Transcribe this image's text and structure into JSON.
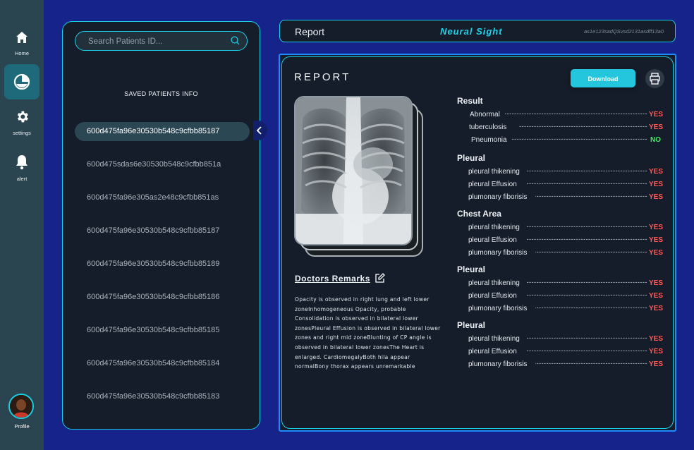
{
  "nav": {
    "items": [
      {
        "label": "Home",
        "icon": "home-icon"
      },
      {
        "label": "",
        "icon": "pie-chart-icon"
      },
      {
        "label": "settings",
        "icon": "gear-icon"
      },
      {
        "label": "alert",
        "icon": "bell-icon"
      }
    ],
    "profile_label": "Profile"
  },
  "patients": {
    "search_placeholder": "Search Patients ID...",
    "title": "SAVED PATIENTS INFO",
    "list": [
      "600d475fa96e30530b548c9cfbb85187",
      "600d475sdas6e30530b548c9cfbb851a",
      "600d475fa96e305as2e48c9cfbb851as",
      "600d475fa96e30530b548c9cfbb85187",
      "600d475fa96e30530b548c9cfbb85189",
      "600d475fa96e30530b548c9cfbb85186",
      "600d475fa96e30530b548c9cfbb85185",
      "600d475fa96e30530b548c9cfbb85184",
      "600d475fa96e30530b548c9cfbb85183"
    ],
    "selected_index": 0
  },
  "header": {
    "title": "Report",
    "brand": "Neural Sight",
    "hash": "as1e123sadQSvsd2131asdff13a0"
  },
  "report": {
    "title": "REPORT",
    "download_label": "Download",
    "remarks_title": "Doctors Remarks",
    "remarks_text": "Opacity is observed in right lung and left lower zoneInhomogeneous Opacity, probable Consolidation is observed in bilateral lower zonesPleural Effusion is observed in bilateral lower zones and right mid zoneBlunting of CP angle is observed in bilateral lower zonesThe Heart is enlarged. CardiomegalyBoth hila appear normalBony thorax appears unremarkable",
    "sections": [
      {
        "title": "Result",
        "rows": [
          {
            "label": "Abnormal",
            "value": "YES"
          },
          {
            "label": "tuberculosis",
            "value": "YES"
          },
          {
            "label": "Pneumonia",
            "value": "NO"
          }
        ]
      },
      {
        "title": "Pleural",
        "rows": [
          {
            "label": "pleural thikening",
            "value": "YES"
          },
          {
            "label": "pleural Effusion",
            "value": "YES"
          },
          {
            "label": "plumonary fiborisis",
            "value": "YES"
          }
        ]
      },
      {
        "title": "Chest Area",
        "rows": [
          {
            "label": "pleural thikening",
            "value": "YES"
          },
          {
            "label": "pleural Effusion",
            "value": "YES"
          },
          {
            "label": "plumonary fiborisis",
            "value": "YES"
          }
        ]
      },
      {
        "title": "Pleural",
        "rows": [
          {
            "label": "pleural thikening",
            "value": "YES"
          },
          {
            "label": "pleural Effusion",
            "value": "YES"
          },
          {
            "label": "plumonary fiborisis",
            "value": "YES"
          }
        ]
      },
      {
        "title": "Pleural",
        "rows": [
          {
            "label": "pleural thikening",
            "value": "YES"
          },
          {
            "label": "pleural Effusion",
            "value": "YES"
          },
          {
            "label": "plumonary fiborisis",
            "value": "YES"
          }
        ]
      }
    ]
  },
  "colors": {
    "background": "#15238a",
    "accent": "#19cfe6",
    "yes": "#ff5a5a",
    "no": "#44ee66"
  }
}
